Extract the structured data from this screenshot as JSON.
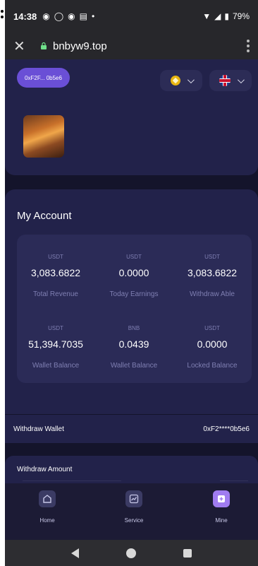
{
  "status_bar": {
    "time": "14:38",
    "battery": "79%"
  },
  "browser": {
    "url": "bnbyw9.top"
  },
  "header": {
    "address_short": "0xF2F... 0b5e6"
  },
  "account": {
    "title": "My Account",
    "stats": [
      {
        "unit": "USDT",
        "value": "3,083.6822",
        "label": "Total Revenue"
      },
      {
        "unit": "USDT",
        "value": "0.0000",
        "label": "Today Earnings"
      },
      {
        "unit": "USDT",
        "value": "3,083.6822",
        "label": "Withdraw Able"
      },
      {
        "unit": "USDT",
        "value": "51,394.7035",
        "label": "Wallet Balance"
      },
      {
        "unit": "BNB",
        "value": "0.0439",
        "label": "Wallet Balance"
      },
      {
        "unit": "USDT",
        "value": "0.0000",
        "label": "Locked Balance"
      }
    ]
  },
  "withdraw_wallet": {
    "label": "Withdraw Wallet",
    "value": "0xF2****0b5e6"
  },
  "withdraw_amount": {
    "label": "Withdraw Amount"
  },
  "tabs": [
    {
      "label": "Home",
      "icon": "home-icon"
    },
    {
      "label": "Service",
      "icon": "chart-icon"
    },
    {
      "label": "Mine",
      "icon": "plus-icon"
    }
  ],
  "colors": {
    "accent": "#6a4fd6",
    "background": "#14142b",
    "card": "#22224a"
  }
}
